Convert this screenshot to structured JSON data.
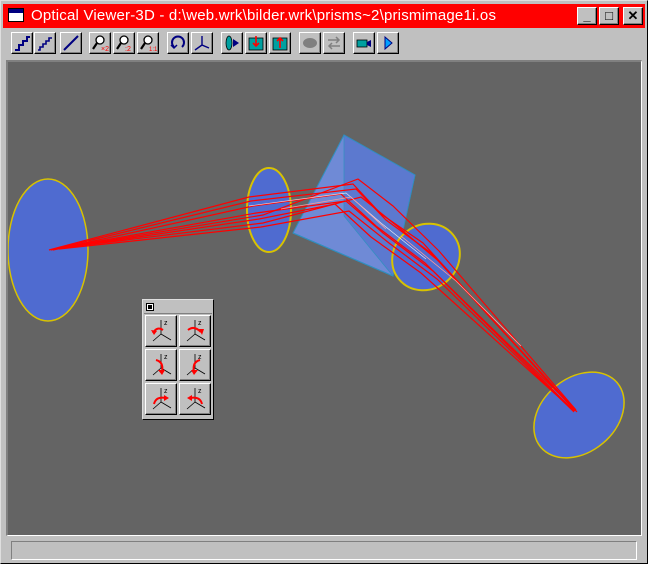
{
  "window": {
    "title": "Optical Viewer-3D - d:\\web.wrk\\bilder.wrk\\prisms~2\\prismimage1i.os",
    "minimize": "_",
    "maximize": "□",
    "close": "✕"
  },
  "toolbar": {
    "buttons": [
      {
        "name": "stair-view-icon"
      },
      {
        "name": "stair-steps-icon"
      },
      {
        "name": "diagonal-line-icon"
      },
      {
        "name": "zoom-in-x2-icon"
      },
      {
        "name": "zoom-out-x2-icon"
      },
      {
        "name": "zoom-1-1-icon"
      },
      {
        "name": "rotate-icon"
      },
      {
        "name": "axes-icon"
      },
      {
        "name": "lens-view-icon"
      },
      {
        "name": "export-icon"
      },
      {
        "name": "import-icon"
      },
      {
        "name": "cloud-icon"
      },
      {
        "name": "swap-icon"
      },
      {
        "name": "camera-icon"
      },
      {
        "name": "play-icon"
      }
    ]
  },
  "palette": {
    "axis_labels": {
      "z": "z",
      "x": "x",
      "y": "y"
    },
    "buttons": [
      "rotate-z-ccw-icon",
      "rotate-z-cw-icon",
      "rotate-x-ccw-icon",
      "rotate-x-cw-icon",
      "rotate-y-ccw-icon",
      "rotate-y-cw-icon"
    ]
  },
  "colors": {
    "titlebar": "#ff0000",
    "viewport_bg": "#646464",
    "lens_fill": "#4f6bd0",
    "lens_edge": "#d8c200",
    "prism_fill": "#5a78cf",
    "ray_color": "#ff0000"
  },
  "status": {
    "text": ""
  }
}
